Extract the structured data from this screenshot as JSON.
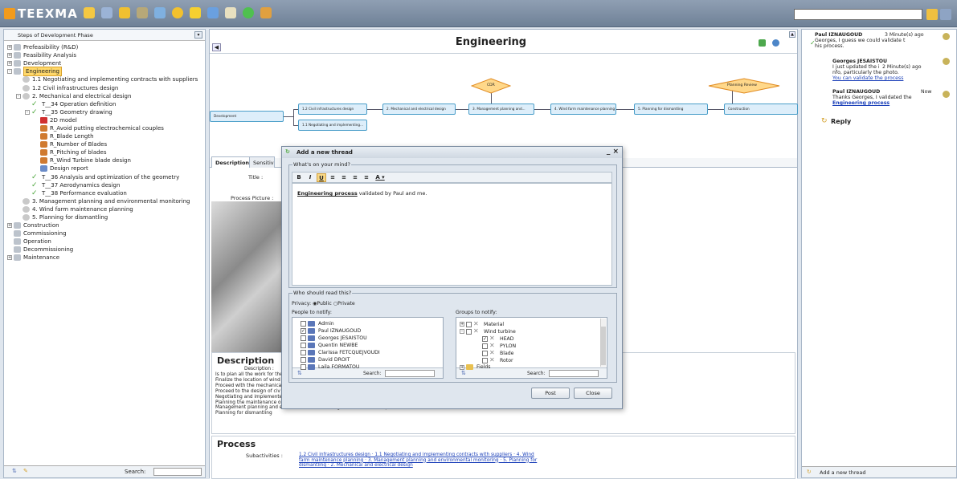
{
  "app": {
    "logo_text": "TEEXMA"
  },
  "left_panel": {
    "phase_select": "Steps of Development Phase",
    "tree": [
      {
        "label": "Prefeasibility (R&D)",
        "indent": 0,
        "icon": "folder",
        "exp": "+"
      },
      {
        "label": "Feasibility Analysis",
        "indent": 0,
        "icon": "folder",
        "exp": "+"
      },
      {
        "label": "Development",
        "indent": 0,
        "icon": "folder",
        "exp": "+"
      },
      {
        "label": "Engineering",
        "indent": 0,
        "icon": "folder",
        "exp": "-",
        "selected": true
      },
      {
        "label": "1.1 Negotiating and implementing contracts with suppliers",
        "indent": 1,
        "icon": "gear"
      },
      {
        "label": "1.2 Civil infrastructures design",
        "indent": 1,
        "icon": "gear"
      },
      {
        "label": "2. Mechanical and electrical design",
        "indent": 1,
        "icon": "gear",
        "exp": "-"
      },
      {
        "label": "T__34 Operation definition",
        "indent": 2,
        "icon": "check"
      },
      {
        "label": "T__35 Geometry drawing",
        "indent": 2,
        "icon": "check",
        "exp": "-"
      },
      {
        "label": "2D model",
        "indent": 3,
        "icon": "red"
      },
      {
        "label": "R_Avoid putting electrochemical couples",
        "indent": 3,
        "icon": "org"
      },
      {
        "label": "R_Blade Length",
        "indent": 3,
        "icon": "org"
      },
      {
        "label": "R_Number of Blades",
        "indent": 3,
        "icon": "org"
      },
      {
        "label": "R_Pitching of blades",
        "indent": 3,
        "icon": "org"
      },
      {
        "label": "R_Wind Turbine blade design",
        "indent": 3,
        "icon": "org"
      },
      {
        "label": "Design report",
        "indent": 3,
        "icon": "doc"
      },
      {
        "label": "T__36 Analysis and optimization of the geometry",
        "indent": 2,
        "icon": "check"
      },
      {
        "label": "T__37 Aerodynamics design",
        "indent": 2,
        "icon": "check"
      },
      {
        "label": "T__38 Performance evaluation",
        "indent": 2,
        "icon": "check"
      },
      {
        "label": "3. Management planning and environmental monitoring",
        "indent": 1,
        "icon": "gear"
      },
      {
        "label": "4. Wind farm maintenance planning",
        "indent": 1,
        "icon": "gear"
      },
      {
        "label": "5. Planning for dismantling",
        "indent": 1,
        "icon": "gear"
      },
      {
        "label": "Construction",
        "indent": 0,
        "icon": "folder",
        "exp": "+"
      },
      {
        "label": "Commissioning",
        "indent": 0,
        "icon": "folder"
      },
      {
        "label": "Operation",
        "indent": 0,
        "icon": "folder"
      },
      {
        "label": "Decommissioning",
        "indent": 0,
        "icon": "folder"
      },
      {
        "label": "Maintenance",
        "indent": 0,
        "icon": "folder",
        "exp": "+"
      }
    ],
    "search_label": "Search:"
  },
  "main": {
    "title": "Engineering",
    "flow": {
      "development": "Development",
      "civil": "1.2 Civil infrastructures design",
      "negotiating": "1.1 Negotiating and implementing...",
      "mechanical": "2. Mechanical and electrical design",
      "management": "3. Management planning and...",
      "windfarm": "4. Wind farm maintenance planning",
      "dismantling": "5. Planning for dismantling",
      "construction": "Construction",
      "cdr": "CDR",
      "planning_review": "Planning Review"
    },
    "tabs": [
      "Description",
      "Sensitive C"
    ],
    "title_label": "Title :",
    "picture_label": "Process Picture :",
    "description": {
      "heading": "Description",
      "label": "Description :",
      "lines": [
        "Is to plan all the work for the",
        "Finalize the location of wind",
        "Proceed with the mechanica",
        "Proceed to the design of civ",
        "Negotiating and implemente",
        "Planning the maintenance o",
        "Management planning and environmental monitoring construction and operation",
        "Planning for dismantling"
      ]
    },
    "process": {
      "heading": "Process",
      "sub_label": "Subactivities :",
      "links": "1.2 Civil infrastructures design · 1.1 Negotiating and implementing contracts with suppliers · 4. Wind farm maintenance planning · 3. Management planning and environmental monitoring · 5. Planning for dismantling · 2. Mechanical and electrical design"
    }
  },
  "right_panel": {
    "c1_user": "Paul IZNAUGOUD",
    "c1_time": "3 Minute(s) ago",
    "c1_text": "Georges, I guess we could validate t\nhis process.",
    "c2_user": "Georges JESAISTOU",
    "c2_text": "I just updated the i\nnfo, particularly the photo.",
    "c2_time": "2 Minute(s) ago",
    "c2_link": "You can validate the process",
    "c3_user": "Paul IZNAUGOUD",
    "c3_time": "Now",
    "c3_text": "Thanks Georges, I validated the",
    "c3_link": "Engineering process",
    "reply": "Reply",
    "footer": "Add a new thread"
  },
  "modal": {
    "title": "Add a new thread",
    "mind_legend": "What's on your mind?",
    "editor_bold": "Engineering process",
    "editor_rest": " validated by Paul and me.",
    "who_legend": "Who should read this?",
    "privacy_label": "Privacy:",
    "public": "Public",
    "private": "Private",
    "people_label": "People to notify:",
    "groups_label": "Groups to notify:",
    "people": [
      {
        "name": "Admin",
        "checked": false
      },
      {
        "name": "Paul IZNAUGOUD",
        "checked": true
      },
      {
        "name": "Georges JESAISTOU",
        "checked": false
      },
      {
        "name": "Quentin NEWBE",
        "checked": false
      },
      {
        "name": "Clarissa FETCQUEJVOUDI",
        "checked": false
      },
      {
        "name": "David DROIT",
        "checked": false
      },
      {
        "name": "Laila FORMATOU",
        "checked": false
      }
    ],
    "groups": [
      {
        "name": "Material",
        "checked": false,
        "indent": 0,
        "exp": "+"
      },
      {
        "name": "Wind turbine",
        "checked": false,
        "indent": 0,
        "exp": "-"
      },
      {
        "name": "HEAD",
        "checked": true,
        "indent": 1
      },
      {
        "name": "PYLON",
        "checked": false,
        "indent": 1
      },
      {
        "name": "Blade",
        "checked": false,
        "indent": 1
      },
      {
        "name": "Rotor",
        "checked": false,
        "indent": 1
      },
      {
        "name": "Fields",
        "checked": false,
        "indent": -1,
        "exp": "+"
      }
    ],
    "search_label": "Search:",
    "post": "Post",
    "close": "Close"
  }
}
